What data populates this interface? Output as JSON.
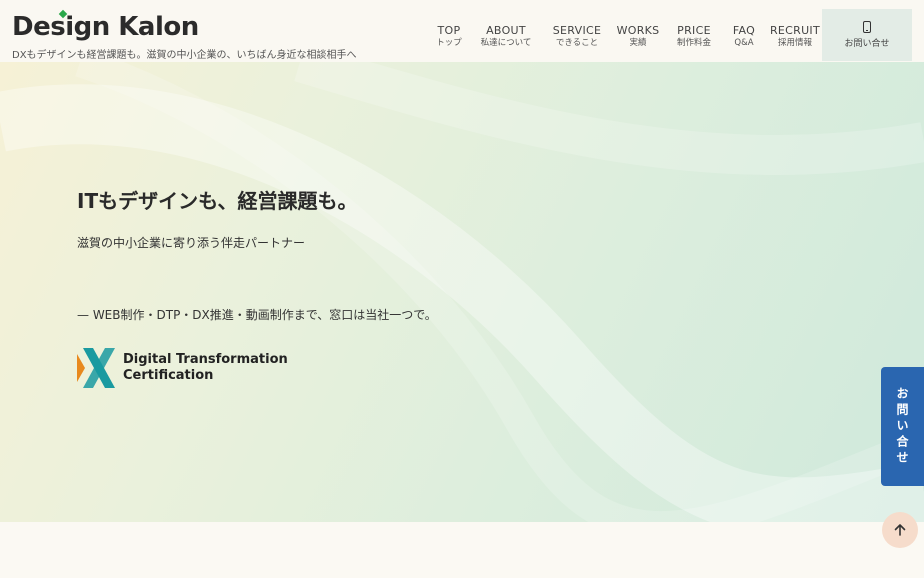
{
  "header": {
    "logo_text": "Design Kalon",
    "tagline": "DXもデザインも経営課題も。滋賀の中小企業の、いちばん身近な相談相手へ",
    "nav": [
      {
        "en": "TOP",
        "jp": "トップ"
      },
      {
        "en": "ABOUT",
        "jp": "私達について"
      },
      {
        "en": "SERVICE",
        "jp": "できること"
      },
      {
        "en": "WORKS",
        "jp": "実績"
      },
      {
        "en": "PRICE",
        "jp": "制作料金"
      },
      {
        "en": "FAQ",
        "jp": "Q&A"
      },
      {
        "en": "RECRUIT",
        "jp": "採用情報"
      }
    ],
    "contact_label": "お問い合せ",
    "contact_icon": "phone-icon"
  },
  "hero": {
    "headline": "ITもデザインも、経営課題も。",
    "subhead": "滋賀の中小企業に寄り添う伴走パートナー",
    "services": "— WEB制作・DTP・DX推進・動画制作まで、窓口は当社一つで。",
    "badge_line1": "Digital Transformation",
    "badge_line2": "Certification"
  },
  "side_tab": {
    "label": "お問い合せ"
  },
  "to_top": {
    "icon": "arrow-up-icon"
  },
  "colors": {
    "accent_blue": "#2a66b0",
    "logo_green": "#2aa84a",
    "badge_orange": "#e8891d",
    "badge_teal": "#1a9aa0"
  }
}
